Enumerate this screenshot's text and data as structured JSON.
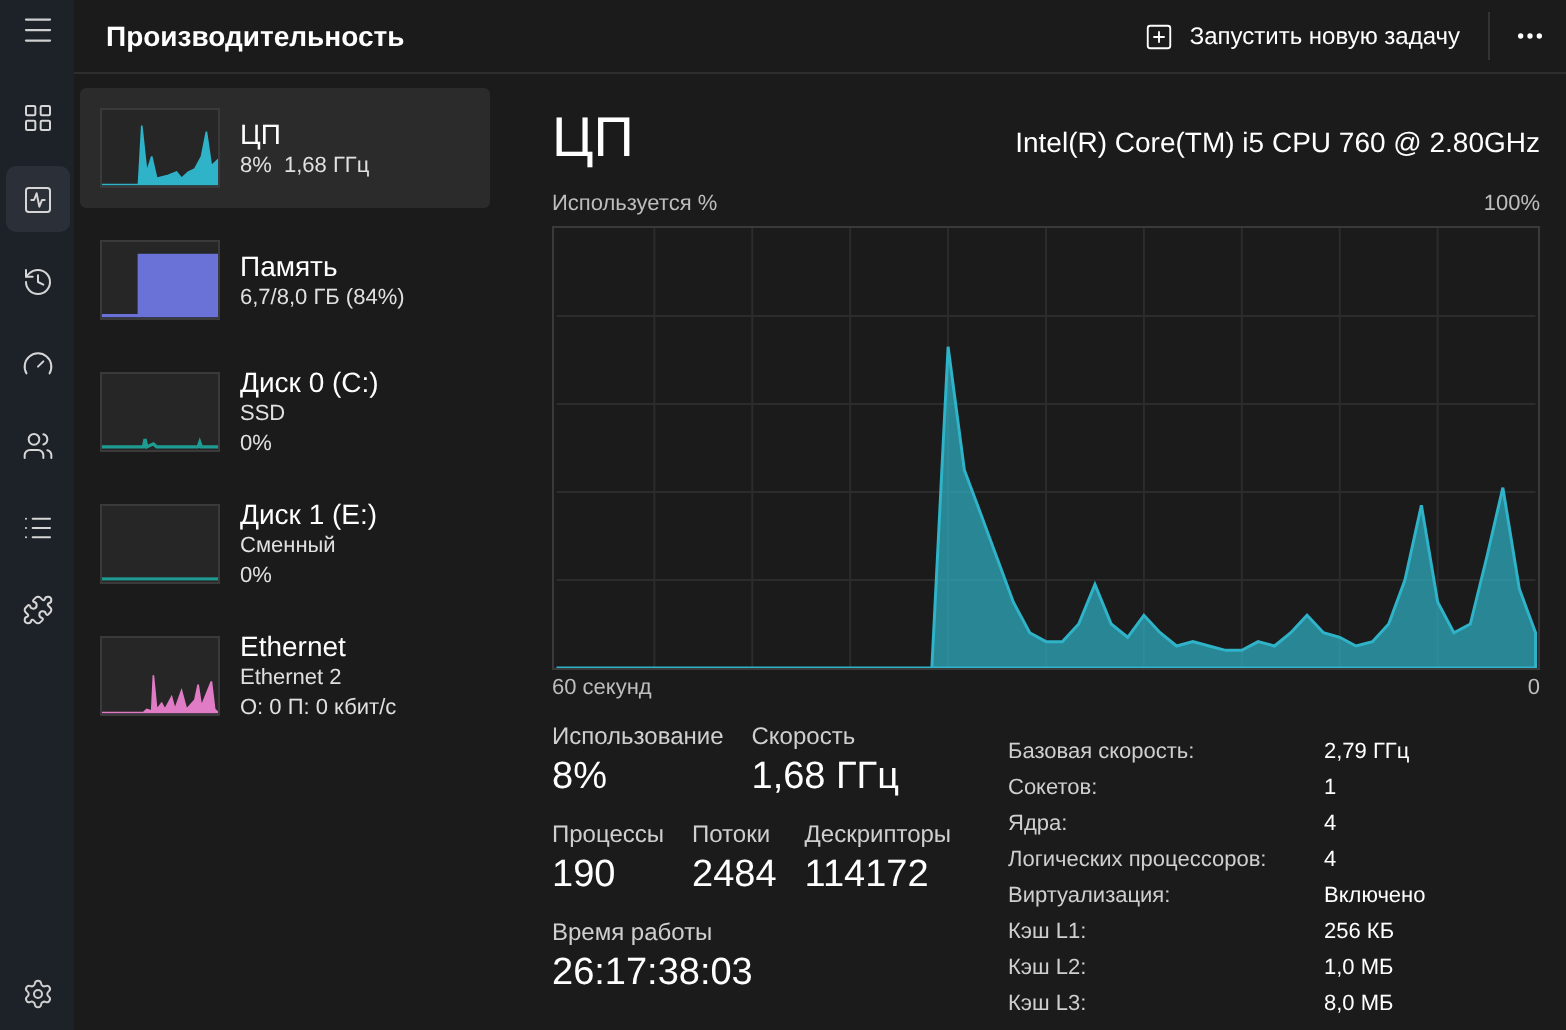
{
  "nav": {
    "items": [
      {
        "selected": false
      },
      {
        "selected": true
      },
      {
        "selected": false
      },
      {
        "selected": false
      },
      {
        "selected": false
      },
      {
        "selected": false
      },
      {
        "selected": false
      }
    ]
  },
  "header": {
    "title": "Производительность",
    "action": "Запустить новую задачу"
  },
  "devices": [
    {
      "kind": "cpu",
      "name": "ЦП",
      "details": [
        "8%  1,68 ГГц"
      ],
      "color": "#2fb3c8",
      "selected": true
    },
    {
      "kind": "memory",
      "name": "Память",
      "details": [
        "6,7/8,0 ГБ (84%)"
      ],
      "color": "#6a72d8",
      "selected": false
    },
    {
      "kind": "disk",
      "name": "Диск 0 (C:)",
      "details": [
        "SSD",
        "0%"
      ],
      "color": "#1e9c92",
      "selected": false
    },
    {
      "kind": "idle",
      "name": "Диск 1 (E:)",
      "details": [
        "Сменный",
        "0%"
      ],
      "color": "#1e9c92",
      "selected": false
    },
    {
      "kind": "network",
      "name": "Ethernet",
      "details": [
        "Ethernet 2",
        "О: 0 П: 0 кбит/с"
      ],
      "color": "#e07cc6",
      "selected": false
    }
  ],
  "detail": {
    "title": "ЦП",
    "model": "Intel(R) Core(TM) i5 CPU 760 @ 2.80GHz",
    "graph": {
      "y_label": "Используется %",
      "y_max_label": "100%",
      "x_start_label": "60 секунд",
      "x_end_label": "0"
    },
    "stats": [
      [
        {
          "label": "Использование",
          "value": "8%"
        },
        {
          "label": "Скорость",
          "value": "1,68 ГГц"
        }
      ],
      [
        {
          "label": "Процессы",
          "value": "190"
        },
        {
          "label": "Потоки",
          "value": "2484"
        },
        {
          "label": "Дескрипторы",
          "value": "114172"
        }
      ],
      [
        {
          "label": "Время работы",
          "value": "26:17:38:03"
        }
      ]
    ],
    "specs": [
      {
        "label": "Базовая скорость:",
        "value": "2,79 ГГц"
      },
      {
        "label": "Сокетов:",
        "value": "1"
      },
      {
        "label": "Ядра:",
        "value": "4"
      },
      {
        "label": "Логических процессоров:",
        "value": "4"
      },
      {
        "label": "Виртуализация:",
        "value": "Включено"
      },
      {
        "label": "Кэш L1:",
        "value": "256 КБ"
      },
      {
        "label": "Кэш L2:",
        "value": "1,0 МБ"
      },
      {
        "label": "Кэш L3:",
        "value": "8,0 МБ"
      }
    ]
  }
}
